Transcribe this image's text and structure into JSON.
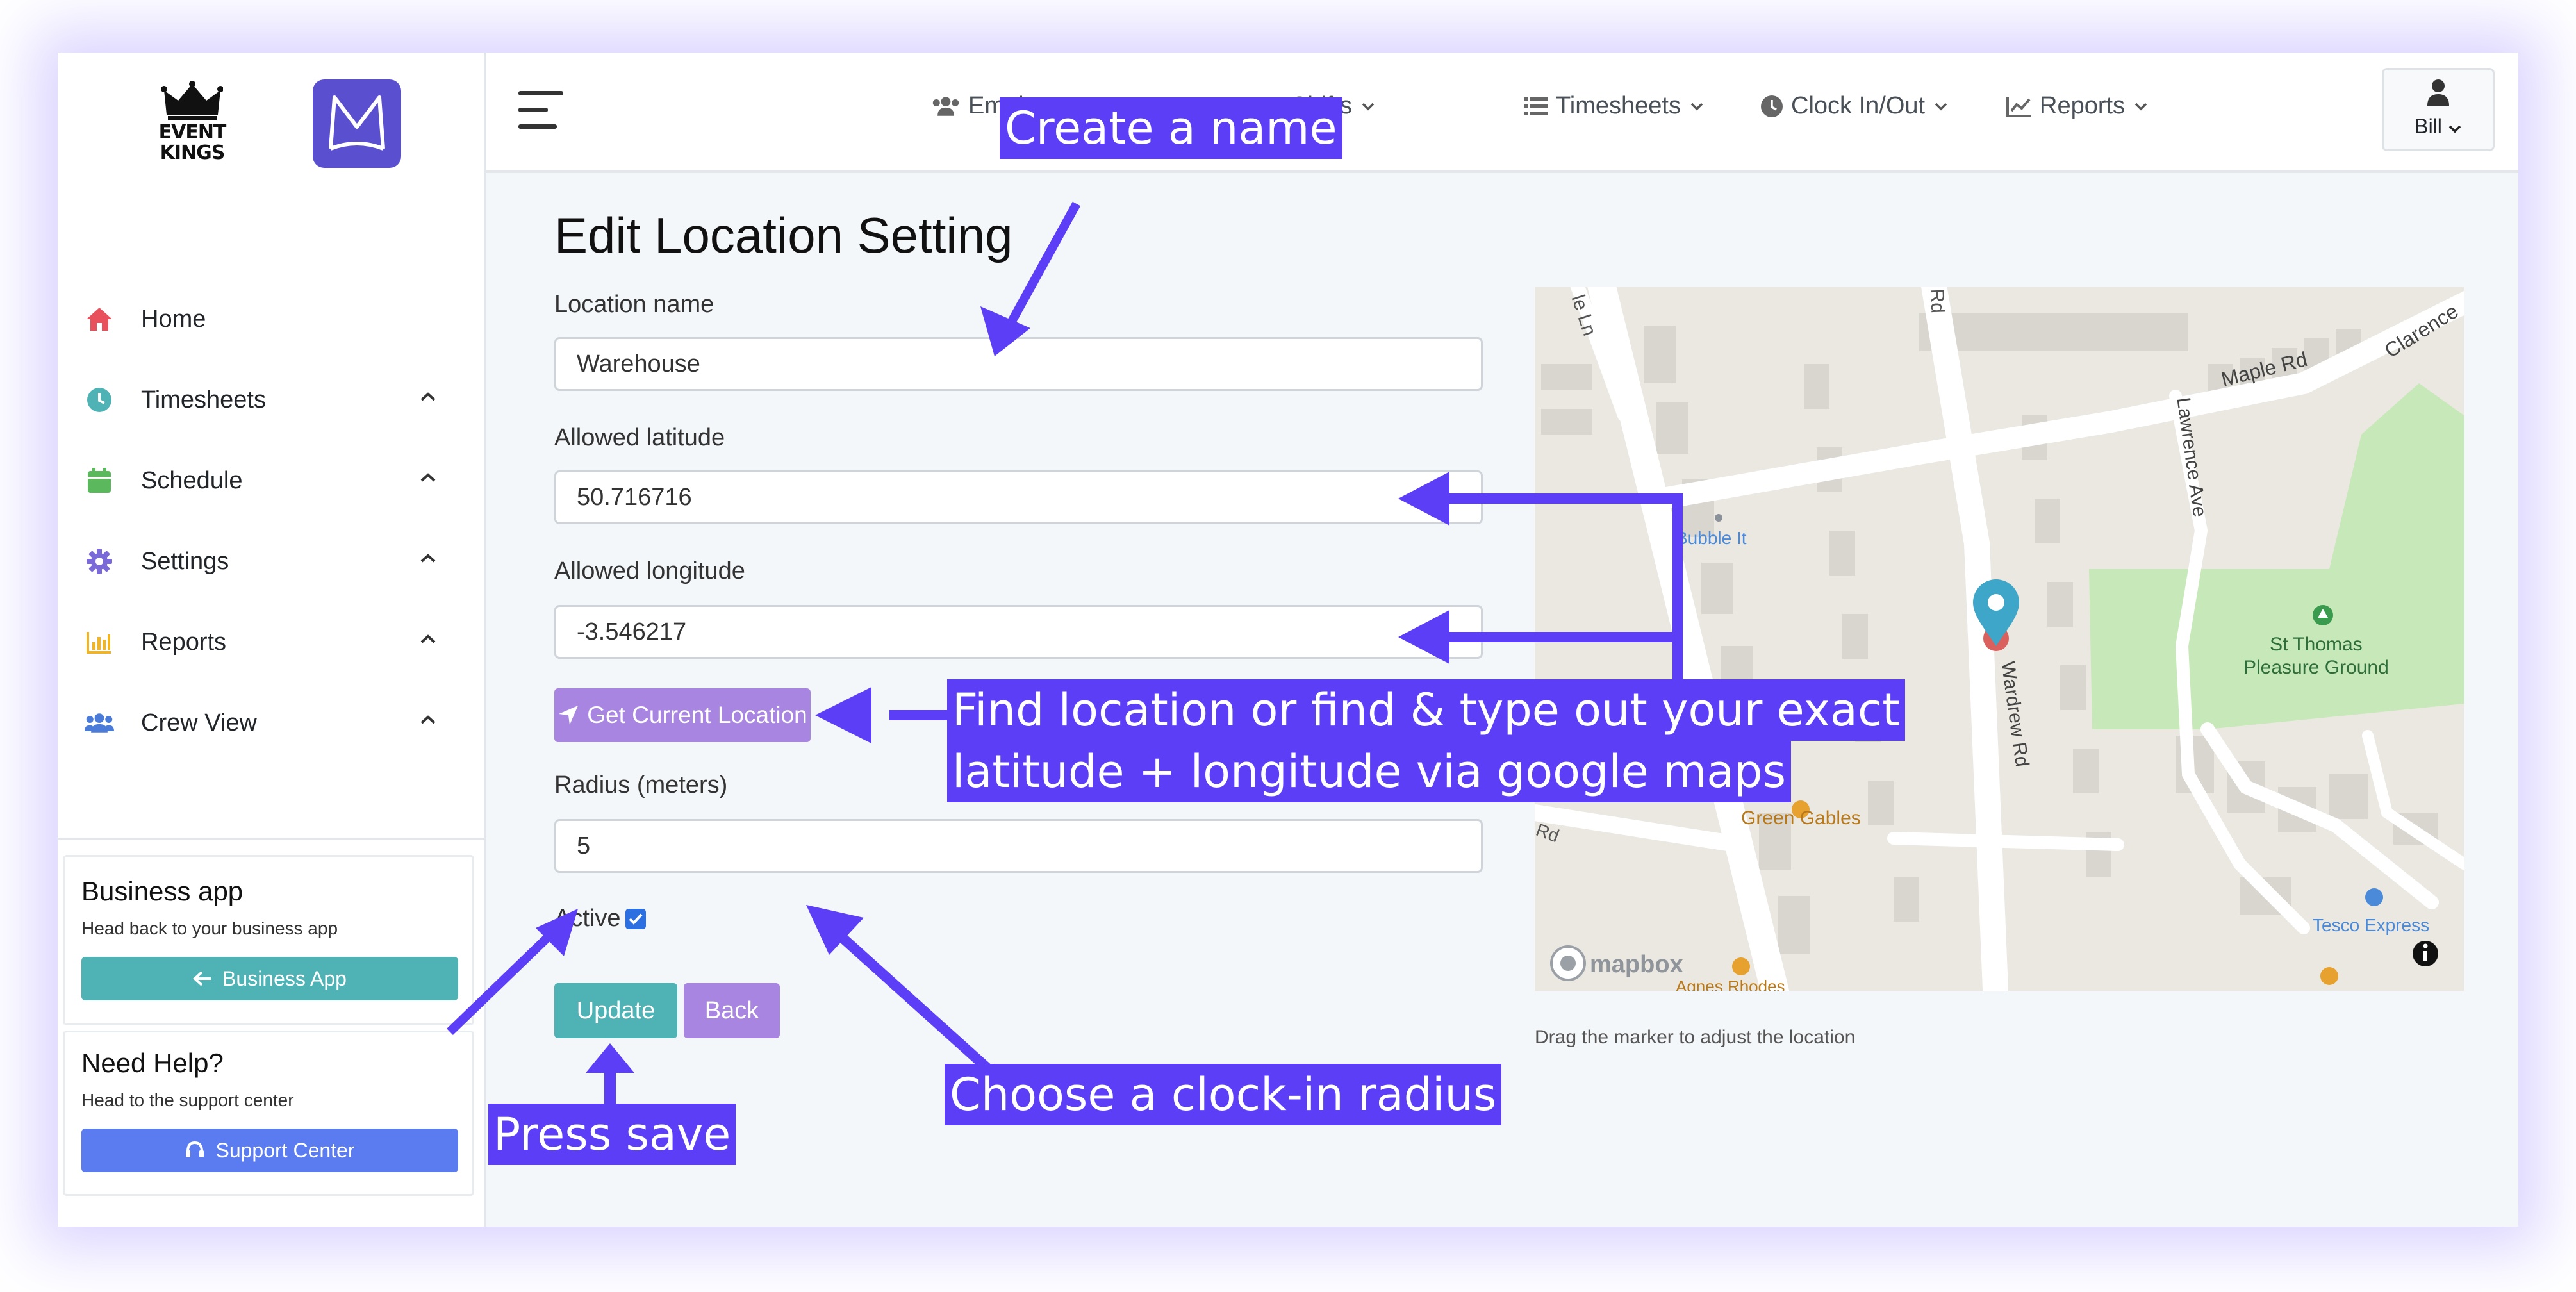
{
  "sidebar": {
    "logo_text": "EVENT\nKINGS",
    "logo_m": "M",
    "items": [
      {
        "label": "Home",
        "icon": "home-icon",
        "color": "#e8505b"
      },
      {
        "label": "Timesheets",
        "icon": "clock-icon",
        "color": "#4fb3b5"
      },
      {
        "label": "Schedule",
        "icon": "calendar-icon",
        "color": "#5cb85c"
      },
      {
        "label": "Settings",
        "icon": "gear-icon",
        "color": "#7a6ad8"
      },
      {
        "label": "Reports",
        "icon": "bar-chart-icon",
        "color": "#f0b429"
      },
      {
        "label": "Crew View",
        "icon": "users-icon",
        "color": "#4a7bd8"
      }
    ],
    "business_card": {
      "title": "Business app",
      "subtitle": "Head back to your business app",
      "button": "Business App"
    },
    "help_card": {
      "title": "Need Help?",
      "subtitle": "Head to the support center",
      "button": "Support Center"
    }
  },
  "topnav": {
    "items": [
      {
        "label": "Employees",
        "icon": "users-icon"
      },
      {
        "label": "Shifts",
        "icon": "shift-icon"
      },
      {
        "label": "Timesheets",
        "icon": "list-icon"
      },
      {
        "label": "Clock In/Out",
        "icon": "clock-icon"
      },
      {
        "label": "Reports",
        "icon": "line-chart-icon"
      }
    ],
    "user": "Bill"
  },
  "form": {
    "title": "Edit Location Setting",
    "name_label": "Location name",
    "name_value": "Warehouse",
    "lat_label": "Allowed latitude",
    "lat_value": "50.716716",
    "lng_label": "Allowed longitude",
    "lng_value": "-3.546217",
    "get_location_button": "Get Current Location",
    "radius_label": "Radius (meters)",
    "radius_value": "5",
    "active_label": "Active",
    "active_checked": true,
    "update_button": "Update",
    "back_button": "Back"
  },
  "map": {
    "hint": "Drag the marker to adjust the location",
    "labels": {
      "street_1": "le Ln",
      "street_2": "Rd",
      "maple": "Maple Rd",
      "clarence": "Clarence",
      "lawrence": "Lawrence Ave",
      "wardrew": "Wardrew Rd",
      "bubble": "Bubble It",
      "park": "St Thomas\nPleasure Ground",
      "gables": "Green Gables",
      "rd_left": "Rd",
      "tesco": "Tesco Express",
      "bottom": "Agnes Rhodes",
      "attribution": "mapbox"
    },
    "colors": {
      "park": "#c7e8b8",
      "road": "#ffffff",
      "marker": "#3ea6c9"
    }
  },
  "annotations": {
    "name": "Create a name",
    "location_line1": "Find location or find & type out your exact",
    "location_line2": "latitude + longitude via google maps",
    "radius": "Choose a clock-in radius",
    "save": "Press save",
    "color": "#5b3ef5"
  }
}
